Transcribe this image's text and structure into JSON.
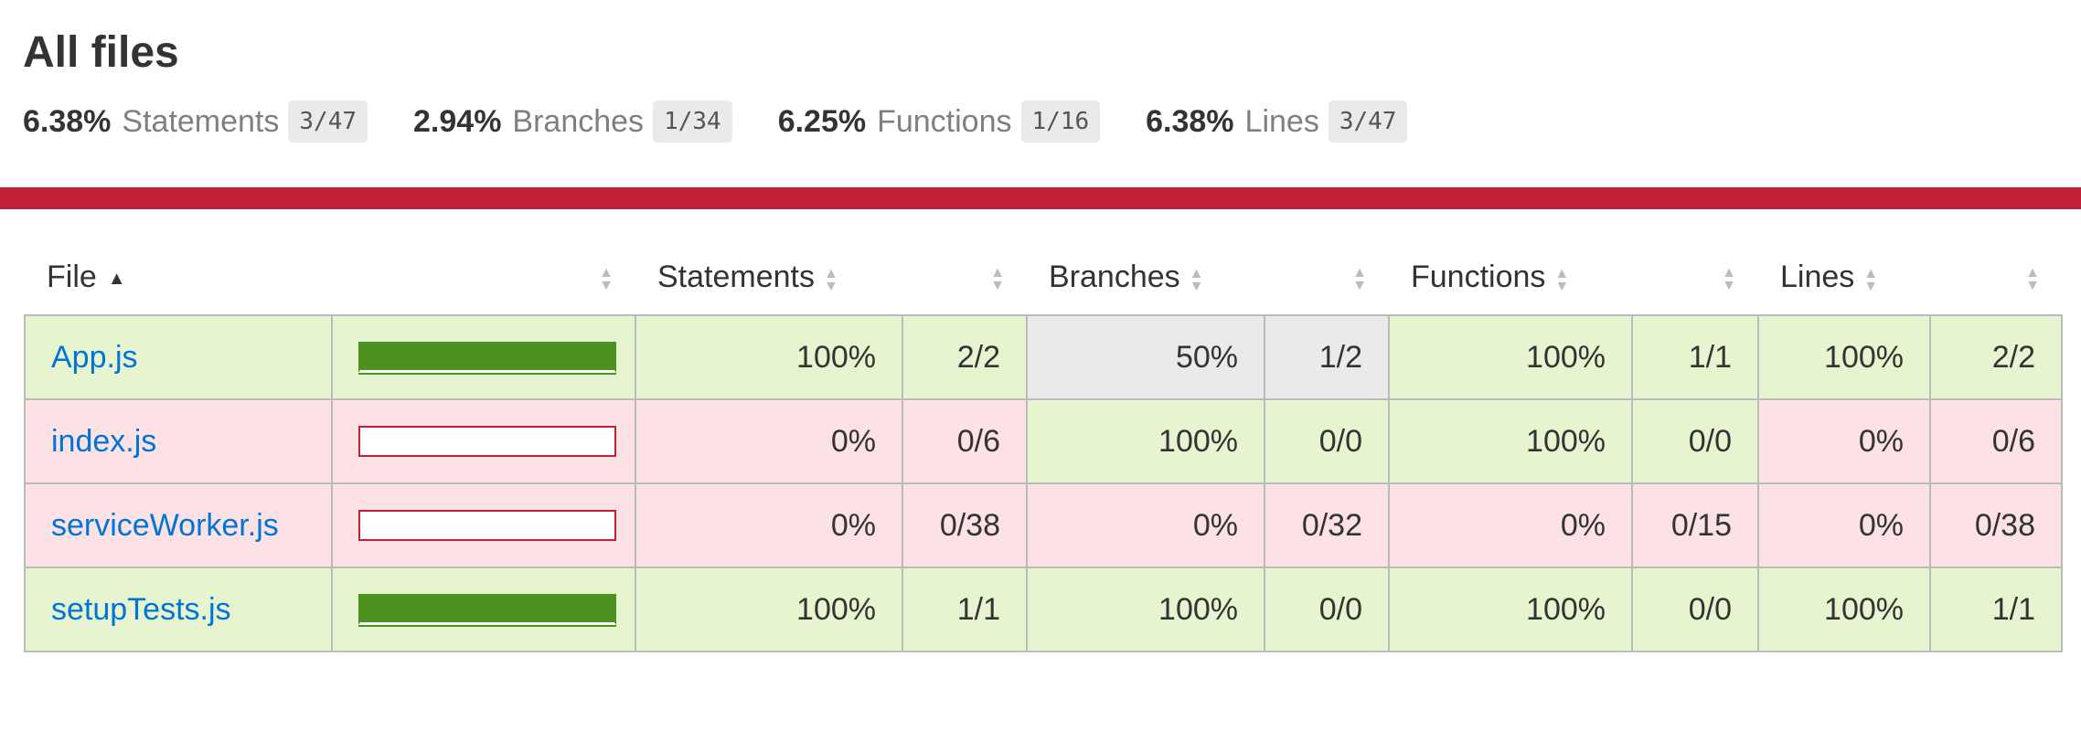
{
  "page": {
    "title": "All files"
  },
  "summary": [
    {
      "pct": "6.38%",
      "label": "Statements",
      "fraction": "3/47"
    },
    {
      "pct": "2.94%",
      "label": "Branches",
      "fraction": "1/34"
    },
    {
      "pct": "6.25%",
      "label": "Functions",
      "fraction": "1/16"
    },
    {
      "pct": "6.38%",
      "label": "Lines",
      "fraction": "3/47"
    }
  ],
  "colors": {
    "low": "#c21f39",
    "high_bar": "#4d9221",
    "high_bg": "#e6f5d0",
    "low_bg": "#fce1e5",
    "medium_bg": "#eaeaea",
    "link": "#0074d9"
  },
  "table": {
    "headers": {
      "file": "File",
      "statements": "Statements",
      "branches": "Branches",
      "functions": "Functions",
      "lines": "Lines"
    },
    "rows": [
      {
        "file": "App.js",
        "bar": "high",
        "bar_pct": 100,
        "stmt_pct": "100%",
        "stmt_frac": "2/2",
        "stmt_cls": "high",
        "br_pct": "50%",
        "br_frac": "1/2",
        "br_cls": "medium",
        "fn_pct": "100%",
        "fn_frac": "1/1",
        "fn_cls": "high",
        "ln_pct": "100%",
        "ln_frac": "2/2",
        "ln_cls": "high"
      },
      {
        "file": "index.js",
        "bar": "low",
        "bar_pct": 0,
        "stmt_pct": "0%",
        "stmt_frac": "0/6",
        "stmt_cls": "low",
        "br_pct": "100%",
        "br_frac": "0/0",
        "br_cls": "high",
        "fn_pct": "100%",
        "fn_frac": "0/0",
        "fn_cls": "high",
        "ln_pct": "0%",
        "ln_frac": "0/6",
        "ln_cls": "low"
      },
      {
        "file": "serviceWorker.js",
        "bar": "low",
        "bar_pct": 0,
        "stmt_pct": "0%",
        "stmt_frac": "0/38",
        "stmt_cls": "low",
        "br_pct": "0%",
        "br_frac": "0/32",
        "br_cls": "low",
        "fn_pct": "0%",
        "fn_frac": "0/15",
        "fn_cls": "low",
        "ln_pct": "0%",
        "ln_frac": "0/38",
        "ln_cls": "low"
      },
      {
        "file": "setupTests.js",
        "bar": "high",
        "bar_pct": 100,
        "stmt_pct": "100%",
        "stmt_frac": "1/1",
        "stmt_cls": "high",
        "br_pct": "100%",
        "br_frac": "0/0",
        "br_cls": "high",
        "fn_pct": "100%",
        "fn_frac": "0/0",
        "fn_cls": "high",
        "ln_pct": "100%",
        "ln_frac": "1/1",
        "ln_cls": "high"
      }
    ]
  }
}
